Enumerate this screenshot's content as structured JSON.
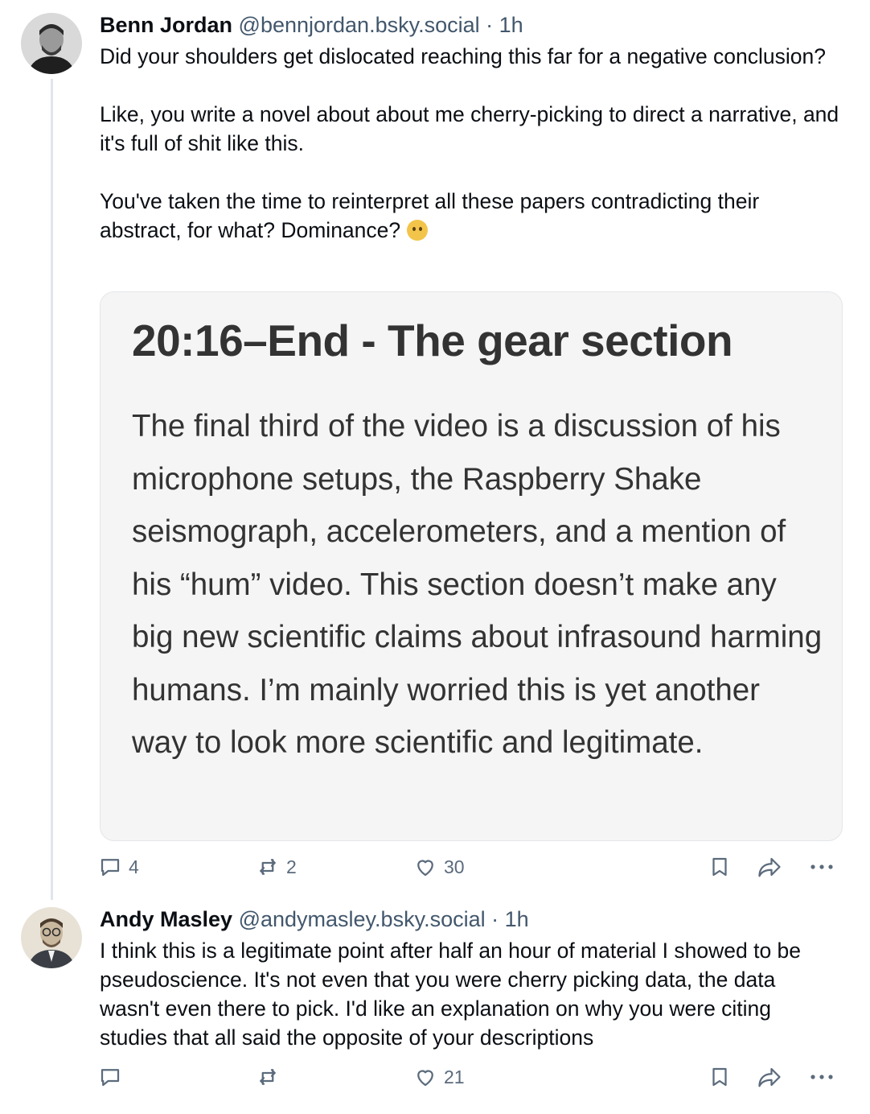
{
  "posts": [
    {
      "name": "Benn Jordan",
      "handle": "@bennjordan.bsky.social",
      "separator": "·",
      "time": "1h",
      "paragraphs": [
        "Did your shoulders get dislocated reaching this far for a negative conclusion?",
        "Like, you write a novel about about me cherry-picking to direct a narrative, and it's full of shit like this.",
        "You've taken the time to reinterpret all these papers contradicting their abstract, for what? Dominance?"
      ],
      "emoji": "🤔",
      "embed": {
        "title": "20:16–End - The gear section",
        "body": "The final third of the video is a discussion of his microphone setups, the Raspberry Shake seismograph, accelerometers, and a mention of his “hum” video. This section doesn’t make any big new scientific claims about infrasound harming humans. I’m mainly worried this is yet another way to look more scientific and legitimate."
      },
      "actions": {
        "replies": "4",
        "reposts": "2",
        "likes": "30"
      }
    },
    {
      "name": "Andy Masley",
      "handle": "@andymasley.bsky.social",
      "separator": "·",
      "time": "1h",
      "text": "I think this is a legitimate point after half an hour of material I showed to be pseudoscience. It's not even that you were cherry picking data, the data wasn't even there to pick. I'd like an explanation on why you were citing studies that all said the opposite of your descriptions",
      "actions": {
        "replies": "",
        "reposts": "",
        "likes": "21"
      }
    }
  ],
  "colors": {
    "text": "#0b0f14",
    "muted": "#42576c",
    "icon": "#5b6b7c",
    "thread_line": "#dfe5ec",
    "embed_bg": "#f5f5f5"
  },
  "icons": [
    "reply-icon",
    "repost-icon",
    "like-icon",
    "bookmark-icon",
    "share-icon",
    "more-icon"
  ]
}
